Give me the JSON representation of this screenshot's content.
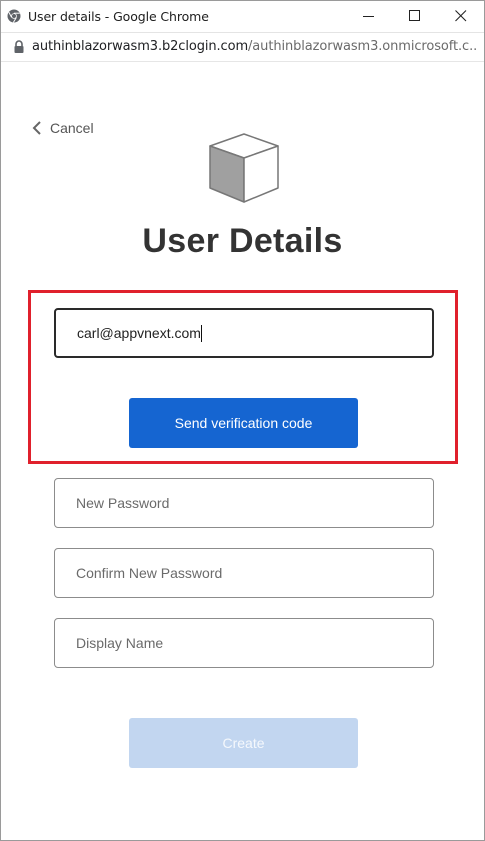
{
  "window": {
    "title": "User details - Google Chrome",
    "url_host": "authinblazorwasm3.b2clogin.com",
    "url_path": "/authinblazorwasm3.onmicrosoft.c..."
  },
  "icons": {
    "browser": "chrome-icon",
    "lock": "lock-icon",
    "back": "chevron-left-icon",
    "logo": "cube-logo",
    "minimize": "minimize-icon",
    "maximize": "maximize-icon",
    "close": "close-icon"
  },
  "page": {
    "cancel_label": "Cancel",
    "heading": "User Details",
    "email_value": "carl@appvnext.com",
    "send_code_label": "Send verification code",
    "new_password_placeholder": "New Password",
    "confirm_password_placeholder": "Confirm New Password",
    "display_name_placeholder": "Display Name",
    "create_label": "Create"
  },
  "colors": {
    "primary_button": "#1565d1",
    "disabled_button": "#c2d6f0",
    "highlight_border": "#e0202c",
    "heading": "#333333"
  }
}
